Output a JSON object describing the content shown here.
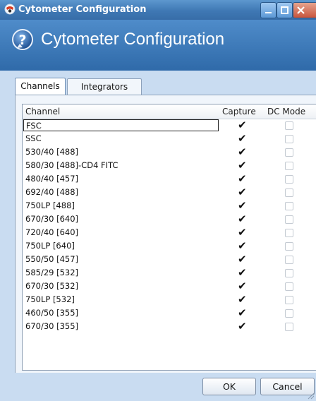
{
  "window": {
    "title": "Cytometer Configuration",
    "header_title": "Cytometer Configuration"
  },
  "tabs": [
    {
      "label": "Channels",
      "active": true
    },
    {
      "label": "Integrators",
      "active": false
    }
  ],
  "grid": {
    "columns": [
      "Channel",
      "Capture",
      "DC Mode"
    ],
    "rows": [
      {
        "channel": "FSC",
        "capture": true,
        "dc_mode": false,
        "selected": true
      },
      {
        "channel": "SSC",
        "capture": true,
        "dc_mode": false
      },
      {
        "channel": "530/40 [488]",
        "capture": true,
        "dc_mode": false
      },
      {
        "channel": "580/30 [488]-CD4 FITC",
        "capture": true,
        "dc_mode": false
      },
      {
        "channel": "480/40 [457]",
        "capture": true,
        "dc_mode": false
      },
      {
        "channel": "692/40 [488]",
        "capture": true,
        "dc_mode": false
      },
      {
        "channel": "750LP [488]",
        "capture": true,
        "dc_mode": false
      },
      {
        "channel": "670/30 [640]",
        "capture": true,
        "dc_mode": false
      },
      {
        "channel": "720/40 [640]",
        "capture": true,
        "dc_mode": false
      },
      {
        "channel": "750LP [640]",
        "capture": true,
        "dc_mode": false
      },
      {
        "channel": "550/50 [457]",
        "capture": true,
        "dc_mode": false
      },
      {
        "channel": "585/29 [532]",
        "capture": true,
        "dc_mode": false
      },
      {
        "channel": "670/30 [532]",
        "capture": true,
        "dc_mode": false
      },
      {
        "channel": "750LP [532]",
        "capture": true,
        "dc_mode": false
      },
      {
        "channel": "460/50 [355]",
        "capture": true,
        "dc_mode": false
      },
      {
        "channel": "670/30 [355]",
        "capture": true,
        "dc_mode": false
      }
    ]
  },
  "footer": {
    "ok_label": "OK",
    "cancel_label": "Cancel"
  },
  "icons": {
    "app": "cytometer-app-icon",
    "help": "question-help-icon",
    "check": "✔"
  }
}
